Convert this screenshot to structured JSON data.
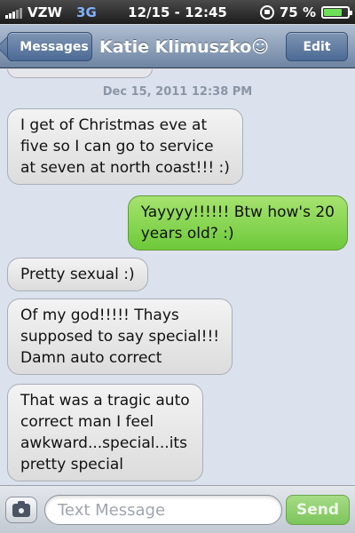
{
  "status_bar": {
    "carrier": "VZW",
    "network": "3G",
    "time": "12/15 - 12:45",
    "battery_text": "75 %",
    "battery_level": 0.75
  },
  "nav": {
    "back_label": "Messages",
    "title": "Katie Klimuszko☺",
    "edit_label": "Edit"
  },
  "conversation": {
    "timestamp": "Dec 15, 2011 12:38 PM",
    "messages": [
      {
        "direction": "in",
        "lines": [
          "I get of Christmas eve at",
          "five so I can go to service",
          "at seven at north coast!!! :)"
        ]
      },
      {
        "direction": "out",
        "lines": [
          "Yayyyy!!!!!! Btw how's 20",
          "years old? :)"
        ]
      },
      {
        "direction": "in",
        "lines": [
          "Pretty sexual :)"
        ]
      },
      {
        "direction": "in",
        "lines": [
          "Of my god!!!!! Thays",
          "supposed to say special!!!",
          "Damn auto correct"
        ]
      },
      {
        "direction": "in",
        "lines": [
          "That was a tragic auto",
          "correct man I feel",
          "awkward...special...its",
          "pretty special"
        ]
      }
    ]
  },
  "input_bar": {
    "placeholder": "Text Message",
    "send_label": "Send"
  },
  "colors": {
    "incoming_bubble": "#e5e5ea",
    "outgoing_bubble": "#7ccc45",
    "nav_bar": "#6d84a2",
    "send_button": "#7cc45b"
  }
}
